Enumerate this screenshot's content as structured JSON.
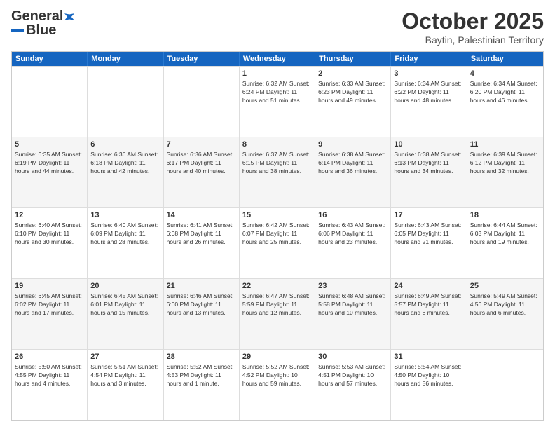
{
  "header": {
    "logo_line1": "General",
    "logo_line2": "Blue",
    "month": "October 2025",
    "location": "Baytin, Palestinian Territory"
  },
  "days_of_week": [
    "Sunday",
    "Monday",
    "Tuesday",
    "Wednesday",
    "Thursday",
    "Friday",
    "Saturday"
  ],
  "rows": [
    [
      {
        "day": "",
        "info": ""
      },
      {
        "day": "",
        "info": ""
      },
      {
        "day": "",
        "info": ""
      },
      {
        "day": "1",
        "info": "Sunrise: 6:32 AM\nSunset: 6:24 PM\nDaylight: 11 hours and 51 minutes."
      },
      {
        "day": "2",
        "info": "Sunrise: 6:33 AM\nSunset: 6:23 PM\nDaylight: 11 hours and 49 minutes."
      },
      {
        "day": "3",
        "info": "Sunrise: 6:34 AM\nSunset: 6:22 PM\nDaylight: 11 hours and 48 minutes."
      },
      {
        "day": "4",
        "info": "Sunrise: 6:34 AM\nSunset: 6:20 PM\nDaylight: 11 hours and 46 minutes."
      }
    ],
    [
      {
        "day": "5",
        "info": "Sunrise: 6:35 AM\nSunset: 6:19 PM\nDaylight: 11 hours and 44 minutes."
      },
      {
        "day": "6",
        "info": "Sunrise: 6:36 AM\nSunset: 6:18 PM\nDaylight: 11 hours and 42 minutes."
      },
      {
        "day": "7",
        "info": "Sunrise: 6:36 AM\nSunset: 6:17 PM\nDaylight: 11 hours and 40 minutes."
      },
      {
        "day": "8",
        "info": "Sunrise: 6:37 AM\nSunset: 6:15 PM\nDaylight: 11 hours and 38 minutes."
      },
      {
        "day": "9",
        "info": "Sunrise: 6:38 AM\nSunset: 6:14 PM\nDaylight: 11 hours and 36 minutes."
      },
      {
        "day": "10",
        "info": "Sunrise: 6:38 AM\nSunset: 6:13 PM\nDaylight: 11 hours and 34 minutes."
      },
      {
        "day": "11",
        "info": "Sunrise: 6:39 AM\nSunset: 6:12 PM\nDaylight: 11 hours and 32 minutes."
      }
    ],
    [
      {
        "day": "12",
        "info": "Sunrise: 6:40 AM\nSunset: 6:10 PM\nDaylight: 11 hours and 30 minutes."
      },
      {
        "day": "13",
        "info": "Sunrise: 6:40 AM\nSunset: 6:09 PM\nDaylight: 11 hours and 28 minutes."
      },
      {
        "day": "14",
        "info": "Sunrise: 6:41 AM\nSunset: 6:08 PM\nDaylight: 11 hours and 26 minutes."
      },
      {
        "day": "15",
        "info": "Sunrise: 6:42 AM\nSunset: 6:07 PM\nDaylight: 11 hours and 25 minutes."
      },
      {
        "day": "16",
        "info": "Sunrise: 6:43 AM\nSunset: 6:06 PM\nDaylight: 11 hours and 23 minutes."
      },
      {
        "day": "17",
        "info": "Sunrise: 6:43 AM\nSunset: 6:05 PM\nDaylight: 11 hours and 21 minutes."
      },
      {
        "day": "18",
        "info": "Sunrise: 6:44 AM\nSunset: 6:03 PM\nDaylight: 11 hours and 19 minutes."
      }
    ],
    [
      {
        "day": "19",
        "info": "Sunrise: 6:45 AM\nSunset: 6:02 PM\nDaylight: 11 hours and 17 minutes."
      },
      {
        "day": "20",
        "info": "Sunrise: 6:45 AM\nSunset: 6:01 PM\nDaylight: 11 hours and 15 minutes."
      },
      {
        "day": "21",
        "info": "Sunrise: 6:46 AM\nSunset: 6:00 PM\nDaylight: 11 hours and 13 minutes."
      },
      {
        "day": "22",
        "info": "Sunrise: 6:47 AM\nSunset: 5:59 PM\nDaylight: 11 hours and 12 minutes."
      },
      {
        "day": "23",
        "info": "Sunrise: 6:48 AM\nSunset: 5:58 PM\nDaylight: 11 hours and 10 minutes."
      },
      {
        "day": "24",
        "info": "Sunrise: 6:49 AM\nSunset: 5:57 PM\nDaylight: 11 hours and 8 minutes."
      },
      {
        "day": "25",
        "info": "Sunrise: 5:49 AM\nSunset: 4:56 PM\nDaylight: 11 hours and 6 minutes."
      }
    ],
    [
      {
        "day": "26",
        "info": "Sunrise: 5:50 AM\nSunset: 4:55 PM\nDaylight: 11 hours and 4 minutes."
      },
      {
        "day": "27",
        "info": "Sunrise: 5:51 AM\nSunset: 4:54 PM\nDaylight: 11 hours and 3 minutes."
      },
      {
        "day": "28",
        "info": "Sunrise: 5:52 AM\nSunset: 4:53 PM\nDaylight: 11 hours and 1 minute."
      },
      {
        "day": "29",
        "info": "Sunrise: 5:52 AM\nSunset: 4:52 PM\nDaylight: 10 hours and 59 minutes."
      },
      {
        "day": "30",
        "info": "Sunrise: 5:53 AM\nSunset: 4:51 PM\nDaylight: 10 hours and 57 minutes."
      },
      {
        "day": "31",
        "info": "Sunrise: 5:54 AM\nSunset: 4:50 PM\nDaylight: 10 hours and 56 minutes."
      },
      {
        "day": "",
        "info": ""
      }
    ]
  ]
}
